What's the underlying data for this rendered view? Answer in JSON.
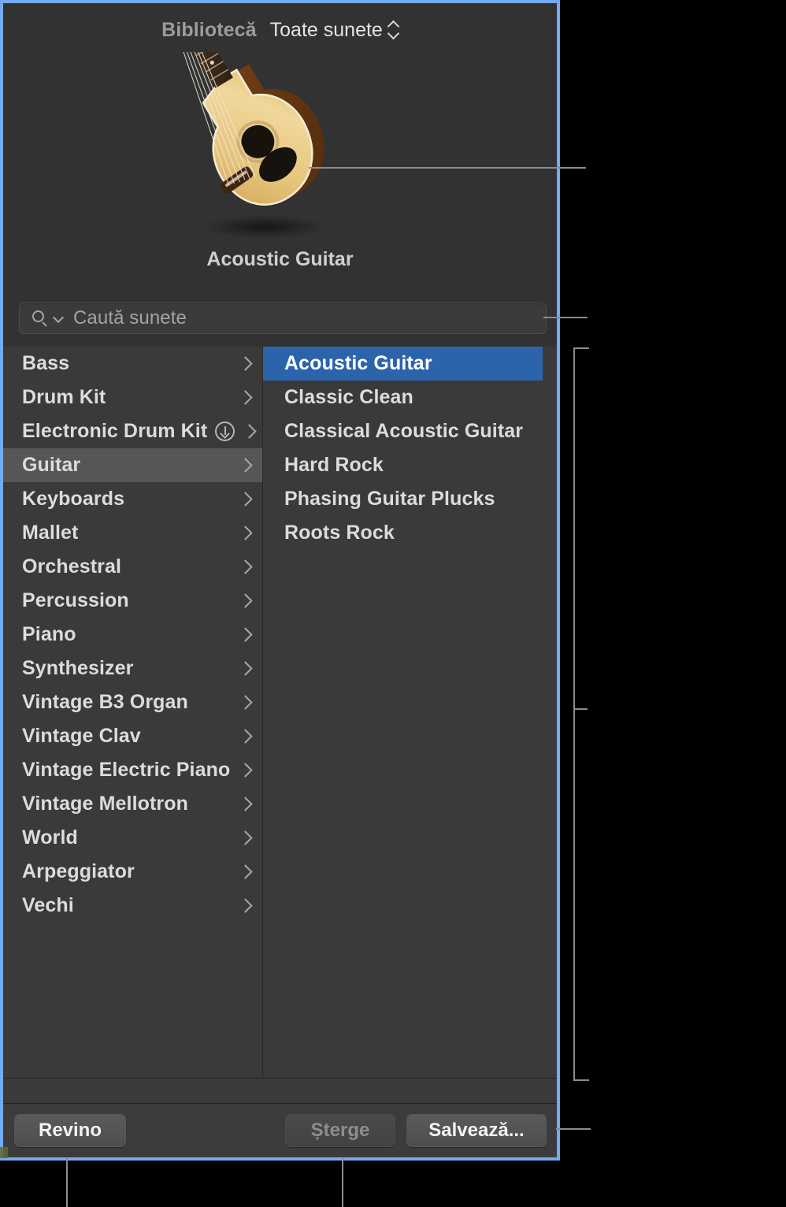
{
  "panel": {
    "header": {
      "library_label": "Bibliotecă",
      "popup_label": "Toate sunete",
      "popup_icon": "chevron-up-down-icon"
    },
    "preview": {
      "instrument_name": "Acoustic Guitar",
      "artwork": "acoustic-guitar-image"
    },
    "search": {
      "icon": "search-icon",
      "dropdown_icon": "chevron-down-icon",
      "placeholder": "Caută sunete",
      "value": ""
    },
    "categories": [
      {
        "label": "Bass",
        "selected": false,
        "download": false,
        "disclosure": "chevron-right-icon"
      },
      {
        "label": "Drum Kit",
        "selected": false,
        "download": false,
        "disclosure": "chevron-right-icon"
      },
      {
        "label": "Electronic Drum Kit",
        "selected": false,
        "download": true,
        "disclosure": "chevron-right-icon"
      },
      {
        "label": "Guitar",
        "selected": true,
        "download": false,
        "disclosure": "chevron-right-icon"
      },
      {
        "label": "Keyboards",
        "selected": false,
        "download": false,
        "disclosure": "chevron-right-icon"
      },
      {
        "label": "Mallet",
        "selected": false,
        "download": false,
        "disclosure": "chevron-right-icon"
      },
      {
        "label": "Orchestral",
        "selected": false,
        "download": false,
        "disclosure": "chevron-right-icon"
      },
      {
        "label": "Percussion",
        "selected": false,
        "download": false,
        "disclosure": "chevron-right-icon"
      },
      {
        "label": "Piano",
        "selected": false,
        "download": false,
        "disclosure": "chevron-right-icon"
      },
      {
        "label": "Synthesizer",
        "selected": false,
        "download": false,
        "disclosure": "chevron-right-icon"
      },
      {
        "label": "Vintage B3 Organ",
        "selected": false,
        "download": false,
        "disclosure": "chevron-right-icon"
      },
      {
        "label": "Vintage Clav",
        "selected": false,
        "download": false,
        "disclosure": "chevron-right-icon"
      },
      {
        "label": "Vintage Electric Piano",
        "selected": false,
        "download": false,
        "disclosure": "chevron-right-icon"
      },
      {
        "label": "Vintage Mellotron",
        "selected": false,
        "download": false,
        "disclosure": "chevron-right-icon"
      },
      {
        "label": "World",
        "selected": false,
        "download": false,
        "disclosure": "chevron-right-icon"
      },
      {
        "label": "Arpeggiator",
        "selected": false,
        "download": false,
        "disclosure": "chevron-right-icon"
      },
      {
        "label": "Vechi",
        "selected": false,
        "download": false,
        "disclosure": "chevron-right-icon"
      }
    ],
    "patches": [
      {
        "label": "Acoustic Guitar",
        "selected": true
      },
      {
        "label": "Classic Clean",
        "selected": false
      },
      {
        "label": "Classical Acoustic Guitar",
        "selected": false
      },
      {
        "label": "Hard Rock",
        "selected": false
      },
      {
        "label": "Phasing Guitar Plucks",
        "selected": false
      },
      {
        "label": "Roots Rock",
        "selected": false
      }
    ],
    "buttons": {
      "revert": "Revino",
      "delete": "Șterge",
      "save": "Salvează..."
    }
  },
  "colors": {
    "panel_focus_border": "#74aaf0",
    "selection_blue": "#2c64ac",
    "category_selection": "#565656",
    "panel_background": "#323232",
    "list_background": "#3a3a3a",
    "callout_line": "#8c8c8c"
  }
}
